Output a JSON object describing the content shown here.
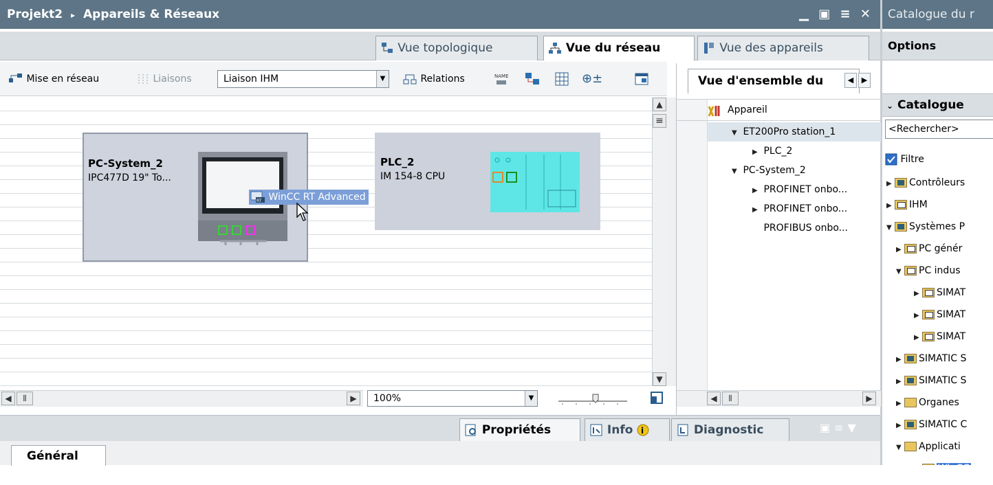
{
  "window": {
    "project": "Projekt2",
    "separator": "▸",
    "section": "Appareils & Réseaux",
    "controls": "▁ ▣ ≡ ✕"
  },
  "catalog_header": {
    "title": "Catalogue du r"
  },
  "view_tabs": [
    {
      "label": "Vue topologique"
    },
    {
      "label": "Vue du réseau"
    },
    {
      "label": "Vue des appareils"
    }
  ],
  "toolbar": {
    "networking_label": "Mise en réseau",
    "connections_label": "Liaisons",
    "connection_type": "Liaison IHM",
    "relations_label": "Relations",
    "zoom_icon_label": "⊕±"
  },
  "canvas": {
    "devices": [
      {
        "name": "PC-System_2",
        "type": "IPC477D 19\" To..."
      },
      {
        "name": "PLC_2",
        "type": "IM 154-8 CPU"
      }
    ],
    "drag_label": "WinCC RT Advanced",
    "zoom": "100%"
  },
  "overview": {
    "tab_label": "Vue d'ensemble du",
    "column_header": "Appareil",
    "rows": [
      {
        "label": "ET200Pro station_1",
        "expander": "▼"
      },
      {
        "label": "PLC_2",
        "expander": "▶"
      },
      {
        "label": "PC-System_2",
        "expander": "▼"
      },
      {
        "label": "PROFINET onbo...",
        "expander": "▶"
      },
      {
        "label": "PROFINET onbo...",
        "expander": "▶"
      },
      {
        "label": "PROFIBUS onbo...",
        "expander": ""
      }
    ]
  },
  "catalog": {
    "options_label": "Options",
    "section_label": "Catalogue",
    "search_placeholder": "<Rechercher>",
    "filter_label": "Filtre",
    "items": [
      {
        "label": "Contrôleurs",
        "expander": "▶"
      },
      {
        "label": "IHM",
        "expander": "▶"
      },
      {
        "label": "Systèmes P",
        "expander": "▼"
      },
      {
        "label": "PC génér",
        "expander": "▶"
      },
      {
        "label": "PC indus",
        "expander": "▼"
      },
      {
        "label": "SIMAT",
        "expander": "▶"
      },
      {
        "label": "SIMAT",
        "expander": "▶"
      },
      {
        "label": "SIMAT",
        "expander": "▶"
      },
      {
        "label": "SIMATIC S",
        "expander": "▶"
      },
      {
        "label": "SIMATIC S",
        "expander": "▶"
      },
      {
        "label": "Organes",
        "expander": "▶"
      },
      {
        "label": "SIMATIC C",
        "expander": "▶"
      },
      {
        "label": "Applicati",
        "expander": "▼"
      },
      {
        "label": "WinCC",
        "expander": ""
      }
    ]
  },
  "bottom": {
    "properties_label": "Propriétés",
    "info_label": "Info",
    "diagnostic_label": "Diagnostic",
    "general_tab": "Général"
  },
  "colors": {
    "title_bar": "#5d7586",
    "accent_cyan": "#5ee6e6",
    "selection": "#3c78d8"
  }
}
